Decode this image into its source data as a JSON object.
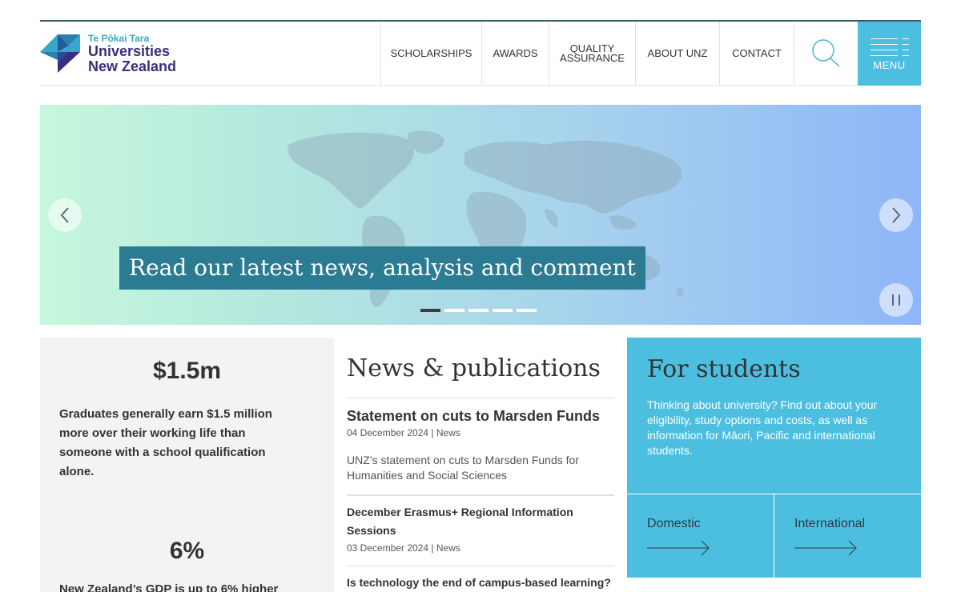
{
  "logo": {
    "maori_name": "Te Pōkai Tara",
    "line1": "Universities",
    "line2": "New Zealand",
    "icon": "unz-triangle-logo"
  },
  "nav": {
    "items": [
      {
        "label": "SCHOLARSHIPS"
      },
      {
        "label": "AWARDS"
      },
      {
        "label_line1": "QUALITY",
        "label_line2": "ASSURANCE"
      },
      {
        "label": "ABOUT UNZ"
      },
      {
        "label": "CONTACT"
      }
    ],
    "search_icon": "search-icon",
    "menu_label": "MENU"
  },
  "hero": {
    "caption": "Read our latest news, analysis and comment",
    "slide_count": 5,
    "active_slide": 1,
    "prev_icon": "chevron-left-icon",
    "next_icon": "chevron-right-icon",
    "pause_icon": "pause-icon"
  },
  "stats": [
    {
      "value": "$1.5m",
      "text": "Graduates generally earn $1.5 million more over their working life than someone with a school qualification alone."
    },
    {
      "value": "6%",
      "text": "New Zealand’s GDP is up to 6% higher"
    }
  ],
  "news": {
    "heading": "News & publications",
    "items": [
      {
        "title": "Statement on cuts to Marsden Funds",
        "meta": "04 December 2024 | News",
        "desc": "UNZ’s statement on cuts to Marsden Funds for Humanities and Social Sciences"
      },
      {
        "title": "December Erasmus+ Regional Information Sessions",
        "meta": "03 December 2024 | News"
      },
      {
        "title": "Is technology the end of campus-based learning?"
      }
    ]
  },
  "students": {
    "heading": "For students",
    "text": "Thinking about university? Find out about your eligibility, study options and costs, as well as information for Māori, Pacific and international students.",
    "links": [
      {
        "label": "Domestic"
      },
      {
        "label": "International"
      }
    ]
  },
  "colors": {
    "accent": "#4cbfe0",
    "nav_text": "#4cb6d4",
    "brand_purple": "#3b2e7e",
    "caption_bg": "#2b7b93"
  }
}
